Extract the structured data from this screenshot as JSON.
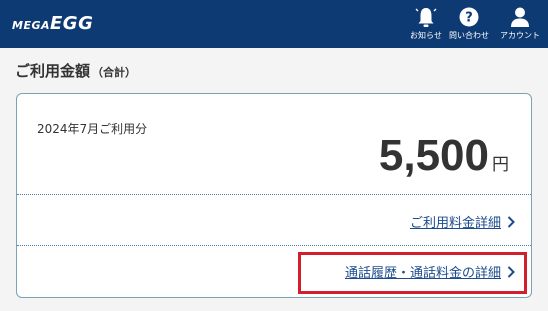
{
  "header": {
    "logo_prefix": "MEGA",
    "logo_main": "EGG",
    "nav": [
      {
        "label": "お知らせ",
        "icon": "bell-icon"
      },
      {
        "label": "問い合わせ",
        "icon": "help-icon"
      },
      {
        "label": "アカウント",
        "icon": "user-icon"
      }
    ]
  },
  "page": {
    "title": "ご利用金額",
    "subtitle": "（合計）"
  },
  "billing": {
    "period_label": "2024年7月ご利用分",
    "amount": "5,500",
    "currency": "円"
  },
  "links": [
    {
      "label": "ご利用料金詳細"
    },
    {
      "label": "通話履歴・通話料金の詳細"
    }
  ],
  "colors": {
    "header_bg": "#0d3a73",
    "link": "#1c4b8d",
    "highlight": "#d31e2d",
    "card_border": "#7aa3b6"
  }
}
